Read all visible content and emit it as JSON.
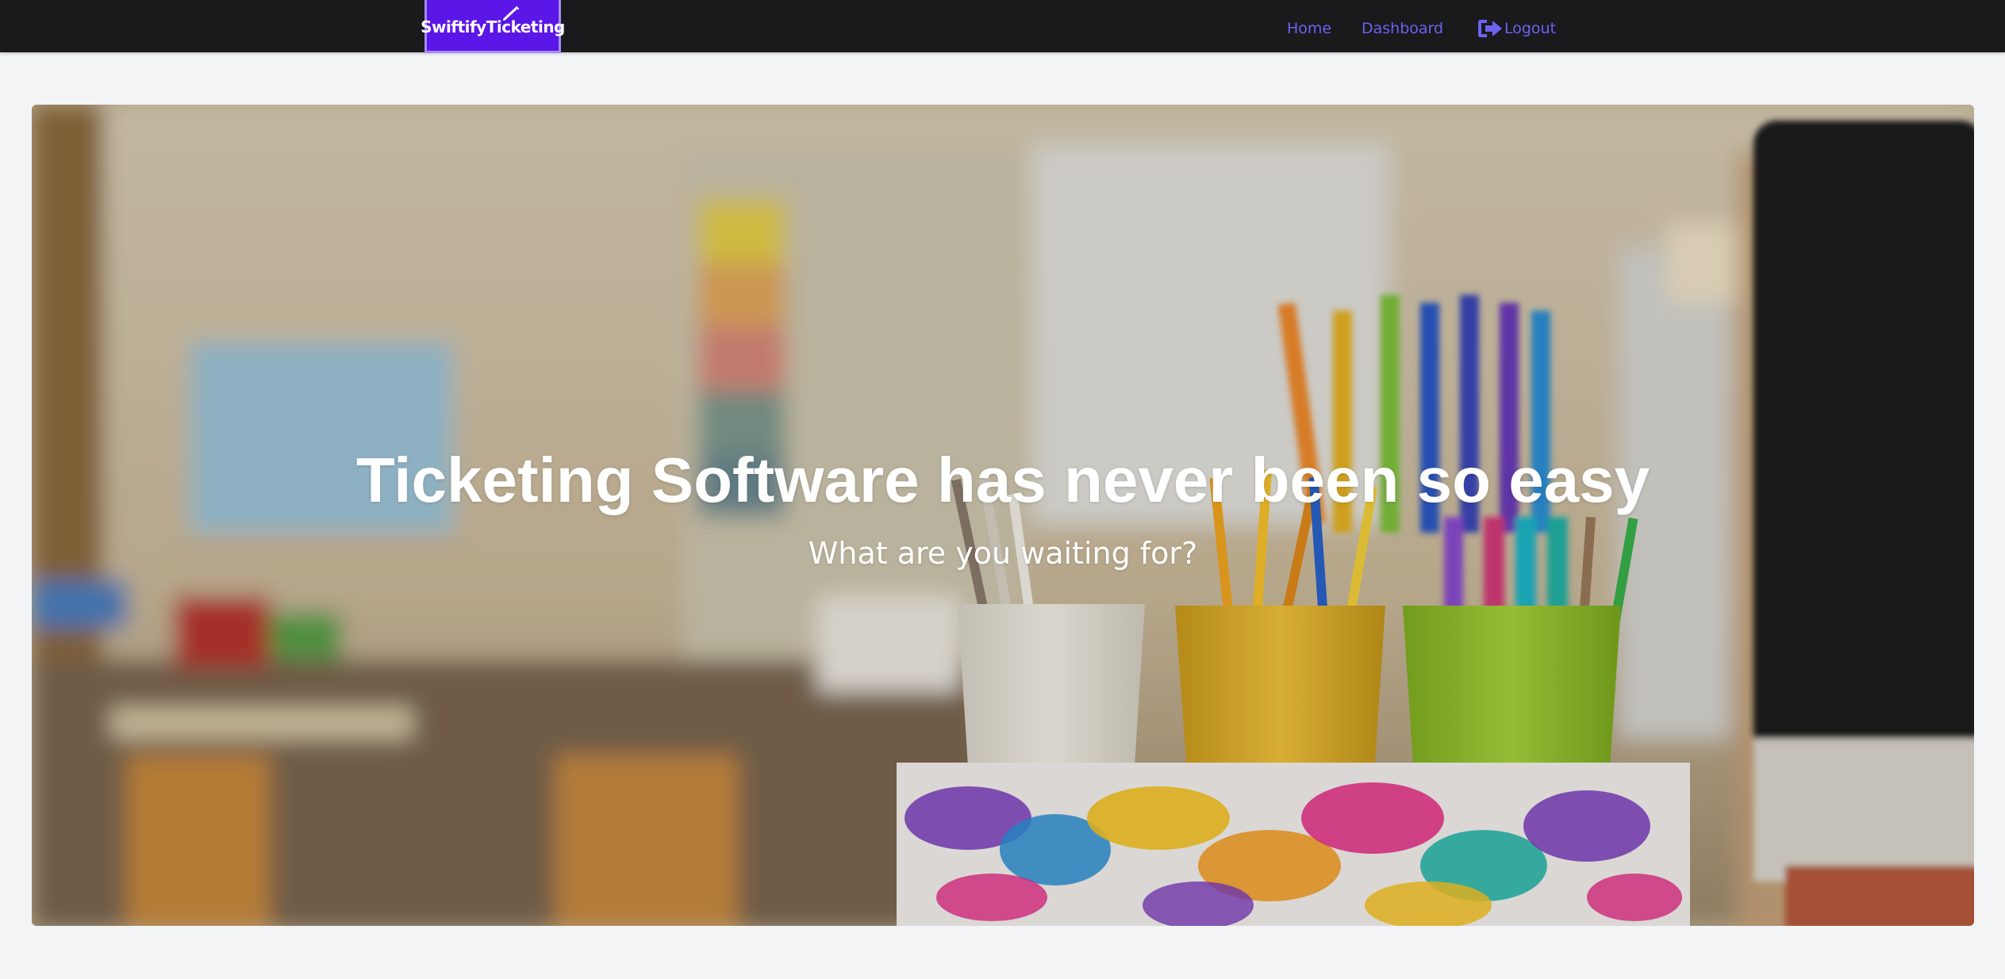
{
  "navbar": {
    "logo_text": "SwiftifyTicketing",
    "links": {
      "home": "Home",
      "dashboard": "Dashboard",
      "logout": "Logout"
    },
    "logout_icon": "sign-out-icon"
  },
  "hero": {
    "title": "Ticketing Software has never been so easy",
    "subtitle": "What are you waiting for?",
    "background": "classroom-with-colored-pencil-cups"
  },
  "colors": {
    "navbar_bg": "#1a191c",
    "brand": "#5b16e8",
    "brand_border": "#a58cf7",
    "link": "#6c63f0",
    "page_bg": "#f3f4f6"
  }
}
